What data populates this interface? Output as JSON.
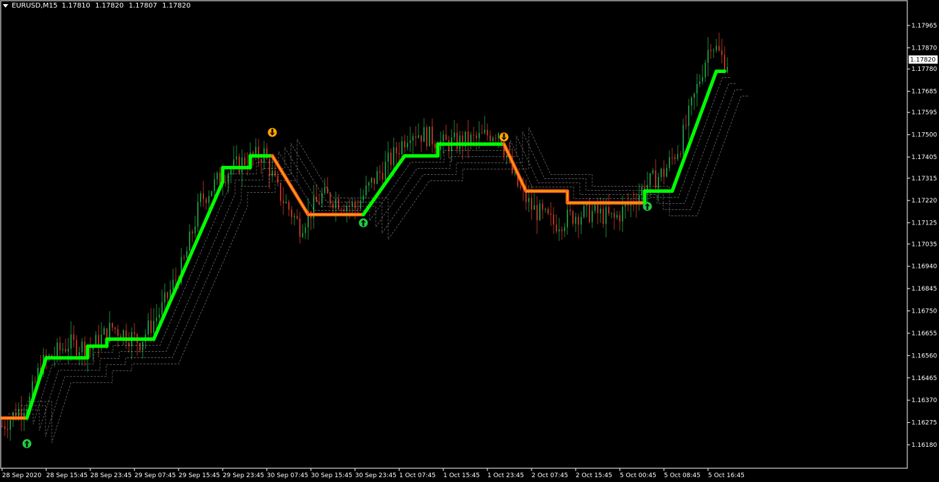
{
  "header": {
    "symbol": "EURUSD,M15",
    "open": "1.17810",
    "high": "1.17820",
    "low": "1.17807",
    "close": "1.17820"
  },
  "colors": {
    "background": "#000000",
    "frame": "#ffffff",
    "bull_candle": "#1a8a3a",
    "bear_candle": "#b03020",
    "trend_up": "#00ff00",
    "trend_down": "#ff5a1e",
    "trend_down_core": "#ffb400",
    "arrow_up": "#22cc44",
    "arrow_down": "#ffa500",
    "trail_lines": "#bbbbbb"
  },
  "chart_data": {
    "type": "candlestick",
    "ylim": [
      1.1616,
      1.1798
    ],
    "y_ticks": [
      "1.17965",
      "1.17870",
      "1.17780",
      "1.17685",
      "1.17595",
      "1.17500",
      "1.17405",
      "1.17315",
      "1.17220",
      "1.17125",
      "1.17035",
      "1.16940",
      "1.16845",
      "1.16750",
      "1.16655",
      "1.16560",
      "1.16465",
      "1.16370",
      "1.16275",
      "1.16180"
    ],
    "current_price": "1.17820",
    "x_ticks": [
      "28 Sep 2020",
      "28 Sep 15:45",
      "28 Sep 23:45",
      "29 Sep 07:45",
      "29 Sep 15:45",
      "29 Sep 23:45",
      "30 Sep 07:45",
      "30 Sep 15:45",
      "30 Sep 23:45",
      "1 Oct 07:45",
      "1 Oct 15:45",
      "1 Oct 23:45",
      "2 Oct 07:45",
      "2 Oct 15:45",
      "5 Oct 00:45",
      "5 Oct 08:45",
      "5 Oct 16:45"
    ],
    "bar_range": [
      0,
      263
    ],
    "price_path": [
      [
        0,
        1.1626
      ],
      [
        10,
        1.1637
      ],
      [
        14,
        1.1652
      ],
      [
        24,
        1.1661
      ],
      [
        32,
        1.1659
      ],
      [
        40,
        1.1668
      ],
      [
        50,
        1.1662
      ],
      [
        58,
        1.1676
      ],
      [
        66,
        1.1696
      ],
      [
        72,
        1.1722
      ],
      [
        80,
        1.1733
      ],
      [
        88,
        1.1739
      ],
      [
        95,
        1.1742
      ],
      [
        100,
        1.1726
      ],
      [
        108,
        1.1711
      ],
      [
        116,
        1.1724
      ],
      [
        122,
        1.1722
      ],
      [
        128,
        1.1719
      ],
      [
        135,
        1.1731
      ],
      [
        142,
        1.1741
      ],
      [
        148,
        1.1752
      ],
      [
        155,
        1.1749
      ],
      [
        160,
        1.1746
      ],
      [
        172,
        1.1748
      ],
      [
        180,
        1.1752
      ],
      [
        186,
        1.173
      ],
      [
        192,
        1.1719
      ],
      [
        200,
        1.1712
      ],
      [
        208,
        1.1716
      ],
      [
        215,
        1.1717
      ],
      [
        222,
        1.1714
      ],
      [
        228,
        1.1721
      ],
      [
        233,
        1.1728
      ],
      [
        240,
        1.1734
      ],
      [
        246,
        1.1746
      ],
      [
        252,
        1.177
      ],
      [
        257,
        1.179
      ],
      [
        262,
        1.1781
      ]
    ],
    "trend_steps": [
      {
        "start": 0,
        "end": 9,
        "level": 1.16294,
        "dir": "down"
      },
      {
        "start": 9,
        "end": 16,
        "level": 1.1655,
        "dir": "up",
        "from": 1.16294
      },
      {
        "start": 16,
        "end": 31,
        "level": 1.1655,
        "dir": "up"
      },
      {
        "start": 31,
        "end": 38,
        "level": 1.166,
        "dir": "up"
      },
      {
        "start": 38,
        "end": 48,
        "level": 1.1663,
        "dir": "up"
      },
      {
        "start": 48,
        "end": 55,
        "level": 1.1663,
        "dir": "up"
      },
      {
        "start": 55,
        "end": 80,
        "level": 1.173,
        "dir": "up",
        "from": 1.1663
      },
      {
        "start": 80,
        "end": 90,
        "level": 1.1736,
        "dir": "up"
      },
      {
        "start": 90,
        "end": 98,
        "level": 1.1741,
        "dir": "up"
      },
      {
        "start": 98,
        "end": 111,
        "level": 1.1716,
        "dir": "down",
        "from": 1.1741
      },
      {
        "start": 111,
        "end": 131,
        "level": 1.1716,
        "dir": "down"
      },
      {
        "start": 131,
        "end": 146,
        "level": 1.1741,
        "dir": "up",
        "from": 1.1716
      },
      {
        "start": 146,
        "end": 158,
        "level": 1.1741,
        "dir": "up"
      },
      {
        "start": 158,
        "end": 182,
        "level": 1.1746,
        "dir": "up"
      },
      {
        "start": 182,
        "end": 190,
        "level": 1.1726,
        "dir": "down",
        "from": 1.1746
      },
      {
        "start": 190,
        "end": 205,
        "level": 1.1726,
        "dir": "down"
      },
      {
        "start": 205,
        "end": 233,
        "level": 1.1721,
        "dir": "down"
      },
      {
        "start": 233,
        "end": 243,
        "level": 1.1726,
        "dir": "up"
      },
      {
        "start": 243,
        "end": 259,
        "level": 1.1777,
        "dir": "up",
        "from": 1.1726
      },
      {
        "start": 259,
        "end": 262,
        "level": 1.1777,
        "dir": "up"
      }
    ],
    "signals": [
      {
        "bar": 9,
        "price": 1.16185,
        "dir": "up"
      },
      {
        "bar": 98,
        "price": 1.1751,
        "dir": "down"
      },
      {
        "bar": 131,
        "price": 1.17125,
        "dir": "up"
      },
      {
        "bar": 182,
        "price": 1.1749,
        "dir": "down"
      },
      {
        "bar": 234,
        "price": 1.17195,
        "dir": "up"
      }
    ]
  }
}
